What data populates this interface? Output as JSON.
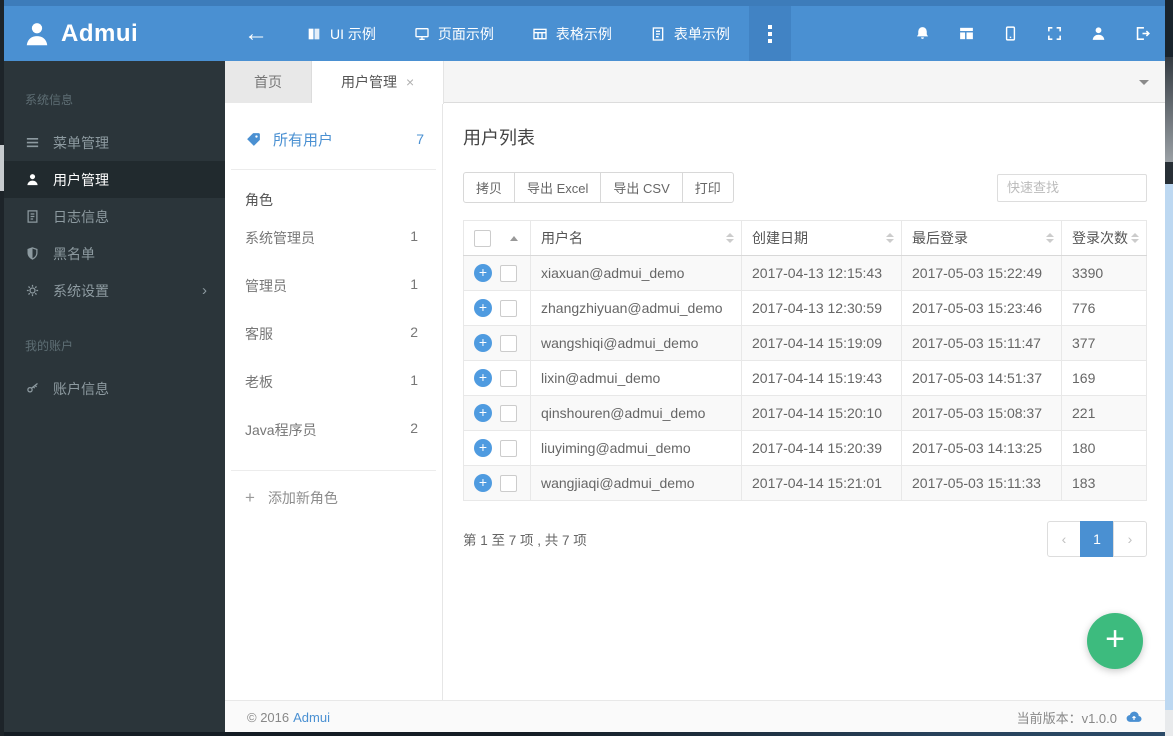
{
  "colors": {
    "navbar": "#4a90d2",
    "navbar_top_strip": "#3d7cba",
    "accent": "#4a90d2",
    "sidebar_bg": "#2b353a",
    "sidebar_active_bg": "#212a2e",
    "fab_green": "#3dbb7e",
    "row_stripe": "#f9f9f9"
  },
  "icons": {
    "back_arrow": "←",
    "close_tab": "×",
    "expand_row": "+",
    "add_role_plus": "+",
    "fab_plus": "+",
    "page_prev": "‹",
    "page_next": "›",
    "settings_chevron": "›"
  },
  "navbar": {
    "brand": "Admui",
    "items": [
      {
        "label": "UI 示例",
        "icon": "book-icon"
      },
      {
        "label": "页面示例",
        "icon": "monitor-icon"
      },
      {
        "label": "表格示例",
        "icon": "table-icon"
      },
      {
        "label": "表单示例",
        "icon": "form-icon"
      }
    ],
    "right_icons": [
      "bell-icon",
      "layout-icon",
      "mobile-icon",
      "fullscreen-icon",
      "user-icon",
      "logout-icon"
    ]
  },
  "sidebar": {
    "sections": [
      {
        "label": "系统信息",
        "items": [
          {
            "label": "菜单管理",
            "icon": "menu-icon",
            "active": false
          },
          {
            "label": "用户管理",
            "icon": "user-icon",
            "active": true
          },
          {
            "label": "日志信息",
            "icon": "file-icon",
            "active": false
          },
          {
            "label": "黑名单",
            "icon": "shield-icon",
            "active": false
          },
          {
            "label": "系统设置",
            "icon": "gear-icon",
            "active": false,
            "expandable": true
          }
        ]
      },
      {
        "label": "我的账户",
        "items": [
          {
            "label": "账户信息",
            "icon": "key-icon",
            "active": false
          }
        ]
      }
    ]
  },
  "tabs": [
    {
      "label": "首页",
      "active": false,
      "closable": false
    },
    {
      "label": "用户管理",
      "active": true,
      "closable": true
    }
  ],
  "user_panel": {
    "all_users_label": "所有用户",
    "all_users_count": "7",
    "roles_header": "角色",
    "roles": [
      {
        "name": "系统管理员",
        "count": "1"
      },
      {
        "name": "管理员",
        "count": "1"
      },
      {
        "name": "客服",
        "count": "2"
      },
      {
        "name": "老板",
        "count": "1"
      },
      {
        "name": "Java程序员",
        "count": "2"
      }
    ],
    "add_role_label": "添加新角色"
  },
  "main": {
    "title": "用户列表",
    "toolbar_buttons": [
      "拷贝",
      "导出 Excel",
      "导出 CSV",
      "打印"
    ],
    "search_placeholder": "快速查找",
    "table": {
      "columns": [
        "用户名",
        "创建日期",
        "最后登录",
        "登录次数"
      ],
      "rows": [
        {
          "username": "xiaxuan@admui_demo",
          "created": "2017-04-13 12:15:43",
          "last_login": "2017-05-03 15:22:49",
          "logins": "3390"
        },
        {
          "username": "zhangzhiyuan@admui_demo",
          "created": "2017-04-13 12:30:59",
          "last_login": "2017-05-03 15:23:46",
          "logins": "776"
        },
        {
          "username": "wangshiqi@admui_demo",
          "created": "2017-04-14 15:19:09",
          "last_login": "2017-05-03 15:11:47",
          "logins": "377"
        },
        {
          "username": "lixin@admui_demo",
          "created": "2017-04-14 15:19:43",
          "last_login": "2017-05-03 14:51:37",
          "logins": "169"
        },
        {
          "username": "qinshouren@admui_demo",
          "created": "2017-04-14 15:20:10",
          "last_login": "2017-05-03 15:08:37",
          "logins": "221"
        },
        {
          "username": "liuyiming@admui_demo",
          "created": "2017-04-14 15:20:39",
          "last_login": "2017-05-03 14:13:25",
          "logins": "180"
        },
        {
          "username": "wangjiaqi@admui_demo",
          "created": "2017-04-14 15:21:01",
          "last_login": "2017-05-03 15:11:33",
          "logins": "183"
        }
      ]
    },
    "info_text": "第 1 至 7 项 , 共 7 项",
    "pagination": {
      "active_page": "1"
    }
  },
  "footer": {
    "copyright": "© 2016",
    "brand_link": "Admui",
    "version_label": "当前版本：v1.0.0"
  }
}
